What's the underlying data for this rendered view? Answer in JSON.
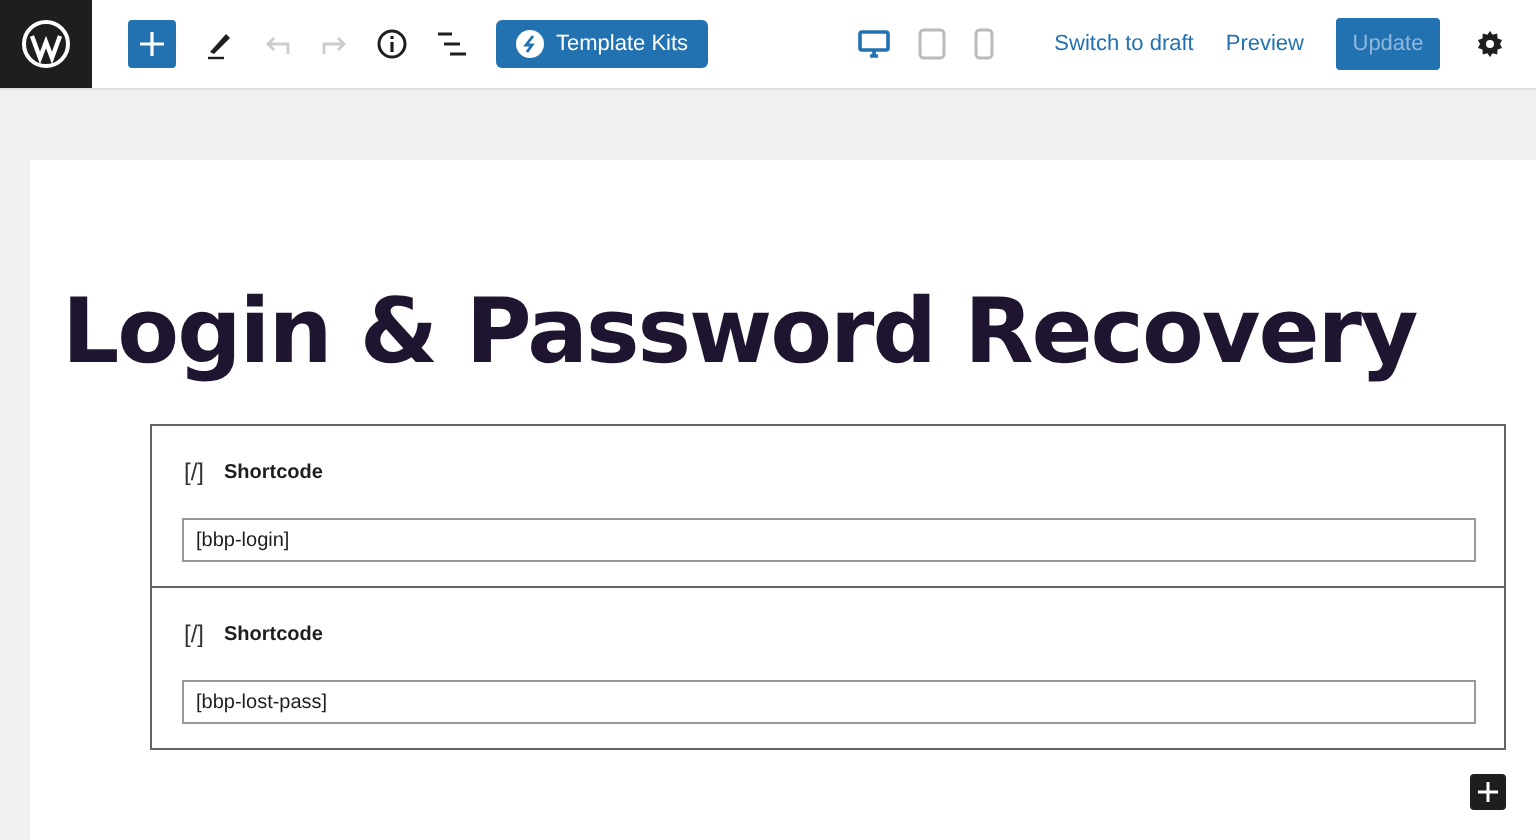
{
  "toolbar": {
    "undo_disabled": true,
    "redo_disabled": true,
    "template_kits": "Template Kits"
  },
  "devices": [
    {
      "kind": "desktop",
      "selected": true
    },
    {
      "kind": "tablet",
      "selected": false
    },
    {
      "kind": "mobile",
      "selected": false
    }
  ],
  "actions": {
    "switch_to_draft": "Switch to draft",
    "preview": "Preview",
    "update": {
      "label": "Update",
      "disabled": true
    }
  },
  "title": "Login & Password Recovery",
  "blocks": [
    {
      "icon": "[/]",
      "label": "Shortcode",
      "value": "[bbp-login]"
    },
    {
      "icon": "[/]",
      "label": "Shortcode",
      "value": "[bbp-lost-pass]"
    }
  ]
}
